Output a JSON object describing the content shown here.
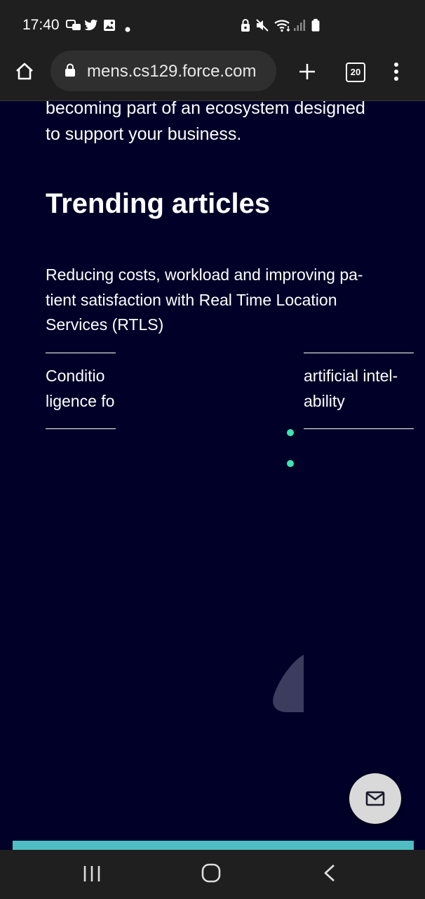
{
  "status_bar": {
    "time": "17:40",
    "notification_icons": [
      "dual-messenger-icon",
      "twitter-icon",
      "gallery-icon",
      "dot-icon"
    ],
    "system_icons": [
      "lock-icon",
      "mute-icon",
      "wifi-icon",
      "signal-icon",
      "battery-icon"
    ]
  },
  "browser": {
    "url": "mens.cs129.force.com",
    "tab_count": "20",
    "icons": [
      "home-icon",
      "lock-icon",
      "new-tab-icon",
      "tab-switcher-icon",
      "menu-icon"
    ]
  },
  "page": {
    "intro_line1": "becoming part of an ecosystem designed",
    "intro_line2": "to support your business.",
    "heading": "Trending articles",
    "articles": [
      {
        "line1": "Reducing costs, workload and improving pa-",
        "line2": "tient satisfaction with Real Time Location",
        "line3": "Services (RTLS)"
      },
      {
        "line1_start": "Conditio",
        "line1_end": "artificial intel-",
        "line2_start": "ligence fo",
        "line2_end": "ability"
      }
    ]
  },
  "fab": {
    "icon": "mail-icon"
  },
  "colors": {
    "background": "#000028",
    "accent_teal": "#50bdc4",
    "dot_green": "#3ce8b0",
    "system_bar": "#1f1f1f"
  },
  "nav_bar": {
    "icons": [
      "recents-icon",
      "home-button-icon",
      "back-icon"
    ]
  }
}
